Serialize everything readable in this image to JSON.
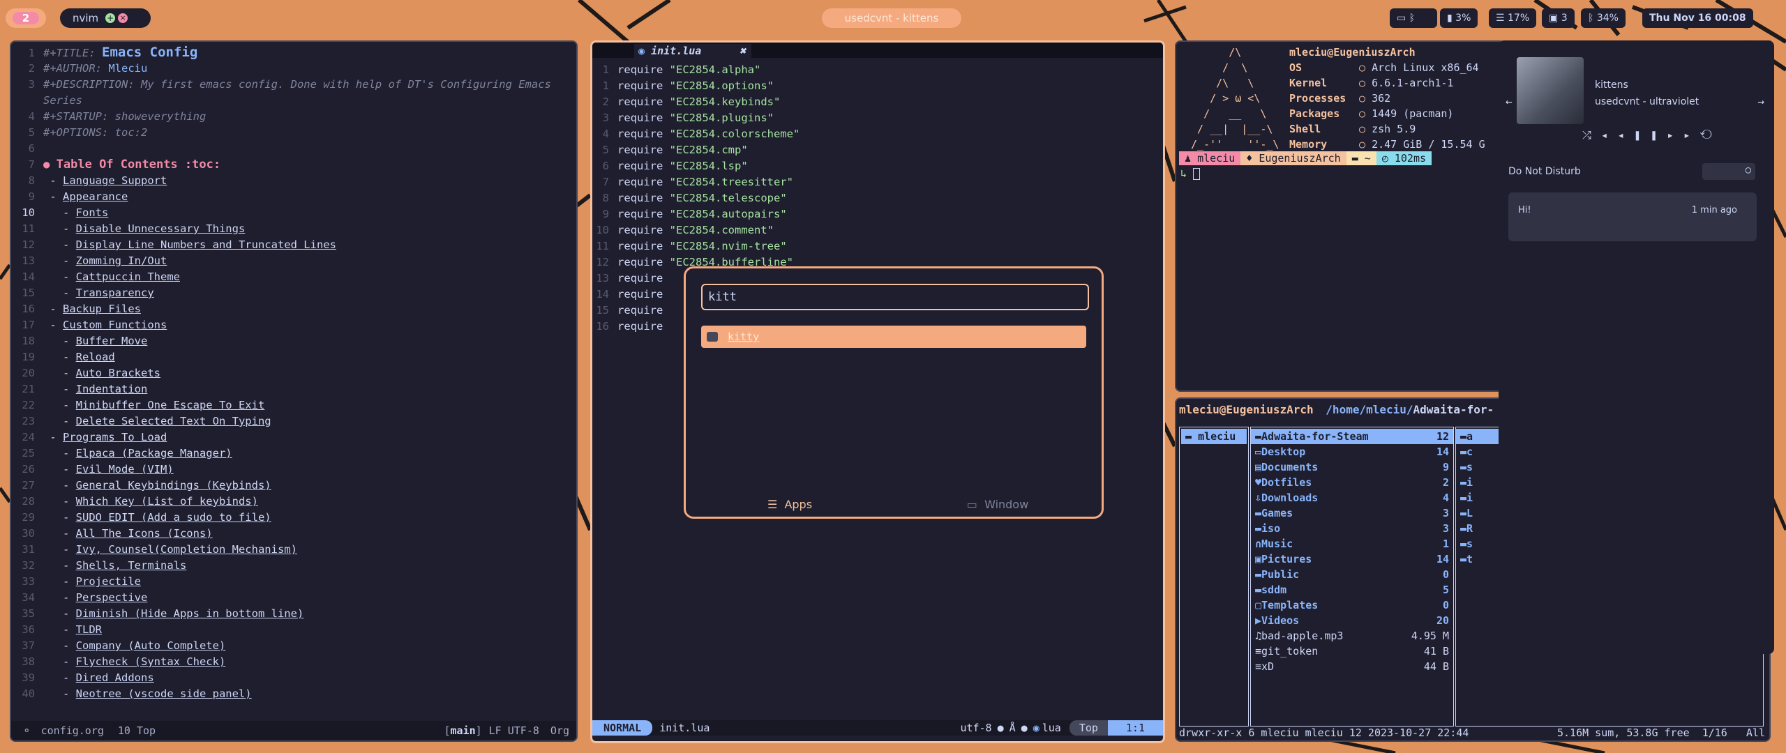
{
  "topbar": {
    "workspace": "2",
    "app_label": "nvim",
    "window_title": "usedcvnt - kittens",
    "status": {
      "battery": "3%",
      "memory": "17%",
      "displays": "3",
      "bluetooth": "34%",
      "datetime": "Thu Nov 16 00:08"
    }
  },
  "emacs": {
    "lines": [
      {
        "n": "1",
        "k": "#+TITLE: ",
        "v": "Emacs Config",
        "style": "title"
      },
      {
        "n": "2",
        "k": "#+AUTHOR: ",
        "v": "Mleciu",
        "style": "author"
      },
      {
        "n": "3",
        "k": "#+DESCRIPTION: ",
        "v": "My first emacs config. Done with help of DT's Configuring Emacs",
        "style": "cm"
      },
      {
        "n": "",
        "k": "",
        "v": "Series",
        "style": "cm"
      },
      {
        "n": "4",
        "k": "#+STARTUP: ",
        "v": "showeverything",
        "style": "cm"
      },
      {
        "n": "5",
        "k": "#+OPTIONS: ",
        "v": "toc:2",
        "style": "cm"
      },
      {
        "n": "6",
        "k": "",
        "v": "",
        "style": "plain"
      },
      {
        "n": "7",
        "k": "● ",
        "v": "Table Of Contents :toc:",
        "style": "heading"
      },
      {
        "n": "8",
        "k": " - ",
        "v": "Language Support",
        "style": "link1"
      },
      {
        "n": "9",
        "k": " - ",
        "v": "Appearance",
        "style": "link1"
      },
      {
        "n": "10",
        "k": "   - ",
        "v": "Fonts",
        "style": "link2"
      },
      {
        "n": "11",
        "k": "   - ",
        "v": "Disable Unnecessary Things",
        "style": "link2"
      },
      {
        "n": "12",
        "k": "   - ",
        "v": "Display Line Numbers and Truncated Lines",
        "style": "link2"
      },
      {
        "n": "13",
        "k": "   - ",
        "v": "Zomming In/Out",
        "style": "link2"
      },
      {
        "n": "14",
        "k": "   - ",
        "v": "Cattpuccin Theme",
        "style": "link2"
      },
      {
        "n": "15",
        "k": "   - ",
        "v": "Transparency",
        "style": "link2"
      },
      {
        "n": "16",
        "k": " - ",
        "v": "Backup Files",
        "style": "link1"
      },
      {
        "n": "17",
        "k": " - ",
        "v": "Custom Functions",
        "style": "link1"
      },
      {
        "n": "18",
        "k": "   - ",
        "v": "Buffer Move",
        "style": "link2"
      },
      {
        "n": "19",
        "k": "   - ",
        "v": "Reload",
        "style": "link2"
      },
      {
        "n": "20",
        "k": "   - ",
        "v": "Auto Brackets",
        "style": "link2"
      },
      {
        "n": "21",
        "k": "   - ",
        "v": "Indentation",
        "style": "link2"
      },
      {
        "n": "22",
        "k": "   - ",
        "v": "Minibuffer One Escape To Exit",
        "style": "link2"
      },
      {
        "n": "23",
        "k": "   - ",
        "v": "Delete Selected Text On Typing",
        "style": "link2"
      },
      {
        "n": "24",
        "k": " - ",
        "v": "Programs To Load",
        "style": "link1"
      },
      {
        "n": "25",
        "k": "   - ",
        "v": "Elpaca (Package Manager)",
        "style": "link2"
      },
      {
        "n": "26",
        "k": "   - ",
        "v": "Evil Mode (VIM)",
        "style": "link2"
      },
      {
        "n": "27",
        "k": "   - ",
        "v": "General Keybindings (Keybinds)",
        "style": "link2"
      },
      {
        "n": "28",
        "k": "   - ",
        "v": "Which Key (List of keybinds)",
        "style": "link2"
      },
      {
        "n": "29",
        "k": "   - ",
        "v": "SUDO EDIT (Add a sudo to file)",
        "style": "link2"
      },
      {
        "n": "30",
        "k": "   - ",
        "v": "All The Icons (Icons)",
        "style": "link2"
      },
      {
        "n": "31",
        "k": "   - ",
        "v": "Ivy, Counsel(Completion Mechanism)",
        "style": "link2"
      },
      {
        "n": "32",
        "k": "   - ",
        "v": "Shells, Terminals",
        "style": "link2"
      },
      {
        "n": "33",
        "k": "   - ",
        "v": "Projectile",
        "style": "link2"
      },
      {
        "n": "34",
        "k": "   - ",
        "v": "Perspective",
        "style": "link2"
      },
      {
        "n": "35",
        "k": "   - ",
        "v": "Diminish (Hide Apps in bottom line)",
        "style": "link2"
      },
      {
        "n": "36",
        "k": "   - ",
        "v": "TLDR",
        "style": "link2"
      },
      {
        "n": "37",
        "k": "   - ",
        "v": "Company (Auto Complete)",
        "style": "link2"
      },
      {
        "n": "38",
        "k": "   - ",
        "v": "Flycheck (Syntax Check)",
        "style": "link2"
      },
      {
        "n": "39",
        "k": "   - ",
        "v": "Dired Addons",
        "style": "link2"
      },
      {
        "n": "40",
        "k": "   - ",
        "v": "Neotree (vscode side panel)",
        "style": "link2"
      }
    ],
    "modeline": {
      "file": "config.org",
      "pos": "10 Top",
      "branch": "main",
      "enc": "LF UTF-8",
      "mode": "Org"
    }
  },
  "nvim": {
    "tab": "init.lua",
    "lines": [
      {
        "n": "1",
        "mod": "EC2854.alpha"
      },
      {
        "n": "1",
        "mod": "EC2854.options"
      },
      {
        "n": "2",
        "mod": "EC2854.keybinds"
      },
      {
        "n": "3",
        "mod": "EC2854.plugins"
      },
      {
        "n": "4",
        "mod": "EC2854.colorscheme"
      },
      {
        "n": "5",
        "mod": "EC2854.cmp"
      },
      {
        "n": "6",
        "mod": "EC2854.lsp"
      },
      {
        "n": "7",
        "mod": "EC2854.treesitter"
      },
      {
        "n": "8",
        "mod": "EC2854.telescope"
      },
      {
        "n": "9",
        "mod": "EC2854.autopairs"
      },
      {
        "n": "10",
        "mod": "EC2854.comment"
      },
      {
        "n": "11",
        "mod": "EC2854.nvim-tree"
      },
      {
        "n": "12",
        "mod": "EC2854.bufferline"
      },
      {
        "n": "13",
        "mod": ""
      },
      {
        "n": "14",
        "mod": ""
      },
      {
        "n": "15",
        "mod": ""
      },
      {
        "n": "16",
        "mod": ""
      }
    ],
    "statusline": {
      "mode": "NORMAL",
      "file": "init.lua",
      "enc": "utf-8",
      "ft": "lua",
      "pos": "Top",
      "cursor": "1:1"
    }
  },
  "launcher": {
    "query": "kitt",
    "result": "kitty",
    "tab_apps": "Apps",
    "tab_window": "Window"
  },
  "fetch": {
    "userhost": "mleciu@EugeniuszArch",
    "rows": [
      {
        "k": "OS",
        "v": "Arch Linux x86_64"
      },
      {
        "k": "Kernel",
        "v": "6.6.1-arch1-1"
      },
      {
        "k": "Processes",
        "v": "362"
      },
      {
        "k": "Packages",
        "v": "1449 (pacman)"
      },
      {
        "k": "Shell",
        "v": "zsh 5.9"
      },
      {
        "k": "Memory",
        "v": "2.47 GiB / 15.54 G"
      }
    ],
    "prompt": {
      "user": "mleciu",
      "host": "EugeniuszArch",
      "dir": "~",
      "time": "102ms"
    }
  },
  "fm": {
    "header_user": "mleciu@EugeniuszArch",
    "header_path": "/home/mleciu/",
    "header_dir": "Adwaita-for-",
    "left": "mleciu",
    "entries": [
      {
        "name": "Adwaita-for-Steam",
        "count": "12",
        "sel": true,
        "icon": "folder"
      },
      {
        "name": "Desktop",
        "count": "14",
        "icon": "desktop"
      },
      {
        "name": "Documents",
        "count": "9",
        "icon": "doc"
      },
      {
        "name": "Dotfiles",
        "count": "2",
        "icon": "heart"
      },
      {
        "name": "Downloads",
        "count": "4",
        "icon": "download"
      },
      {
        "name": "Games",
        "count": "3",
        "icon": "folder"
      },
      {
        "name": "iso",
        "count": "3",
        "icon": "folder"
      },
      {
        "name": "Music",
        "count": "1",
        "icon": "headphones"
      },
      {
        "name": "Pictures",
        "count": "14",
        "icon": "image"
      },
      {
        "name": "Public",
        "count": "0",
        "icon": "folder"
      },
      {
        "name": "sddm",
        "count": "5",
        "icon": "folder"
      },
      {
        "name": "Templates",
        "count": "0",
        "icon": "template"
      },
      {
        "name": "Videos",
        "count": "20",
        "icon": "video"
      },
      {
        "name": "bad-apple.mp3",
        "count": "4.95 M",
        "file": true,
        "icon": "music"
      },
      {
        "name": "git_token",
        "count": "41 B",
        "file": true,
        "icon": "text"
      },
      {
        "name": "xD",
        "count": "44 B",
        "file": true,
        "icon": "text"
      }
    ],
    "preview": [
      "a",
      "c",
      "s",
      "i",
      "i",
      "L",
      "R",
      "s",
      "t"
    ],
    "status_left": "drwxr-xr-x 6 mleciu mleciu 12 2023-10-27 22:44",
    "status_right": "5.16M sum, 53.8G free  1/16   All"
  },
  "notif": {
    "player_title": "kittens",
    "player_artist": "usedcvnt - ultraviolet",
    "dnd": "Do Not Disturb",
    "msg": "Hi!",
    "msg_time": "1 min ago"
  }
}
